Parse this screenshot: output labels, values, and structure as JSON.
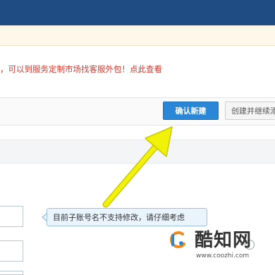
{
  "notice": {
    "text": "，可以到服务定制市场找客服外包！",
    "link": "点此查看"
  },
  "toolbar": {
    "confirm_label": "确认新建",
    "create_continue_label": "创建并继续添加"
  },
  "tooltip": {
    "text": "目前子账号名不支持修改，请仔细考虑"
  },
  "watermark": {
    "logo_icon": "coozhi-logo-icon",
    "title": "酷知网",
    "url": "www.coozhi.com"
  },
  "colors": {
    "header": "#1f4c82",
    "primary_button": "#2a86d6",
    "notice_text": "#d9362b",
    "annotation_arrow": "#f1f10a"
  }
}
